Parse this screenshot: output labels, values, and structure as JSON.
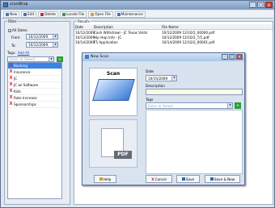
{
  "window": {
    "title": "scanWrap"
  },
  "toolbar": {
    "new": "New",
    "edit": "Edit",
    "delete": "Delete",
    "locate": "Locate File",
    "open": "Open File",
    "maintenance": "Maintenance"
  },
  "filters": {
    "legend": "Filter",
    "all_dates": "All Dates",
    "from_label": "From:",
    "from_value": "10/12/2009",
    "to_label": "To:",
    "to_value": "10/12/2009",
    "tags_label": "Tags:",
    "add_all": "Add All",
    "tag_placeholder": "Enter or Select",
    "tags": [
      "Banking",
      "Insurance",
      "JC",
      "JC w/ Software",
      "Kids",
      "Rate Increase",
      "Sponsorships"
    ]
  },
  "results": {
    "legend": "Results",
    "headers": [
      "Date",
      "Description",
      "File Name",
      ""
    ],
    "rows": [
      [
        "10/12/2009",
        "Cash Withdrawl - JC Texas Visits",
        "10/12/2009 12/10/2_00000.pdf",
        ""
      ],
      [
        "10/13/2009",
        "Hip Hop Info - JC",
        "10/12/2009 12/10/2_T/1.pdf",
        ""
      ],
      [
        "10/14/2009",
        "F5 Application",
        "10/14/2009 12/10/2_00001.pdf",
        ""
      ]
    ]
  },
  "dialog": {
    "title": "New Scan",
    "scan": "Scan",
    "pdf": "PDF",
    "date_label": "Date",
    "date_value": "10/15/2009",
    "desc_label": "Description",
    "tags_label": "Tags",
    "tag_placeholder": "Enter or Select",
    "help": "Help",
    "cancel": "Cancel",
    "save": "Save",
    "save_new": "Save & New"
  }
}
